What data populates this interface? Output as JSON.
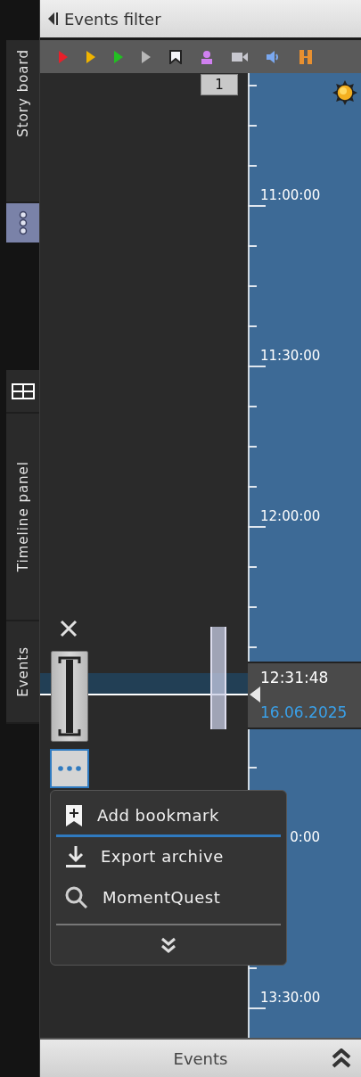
{
  "sidebar": {
    "items": [
      {
        "kind": "tab",
        "label": "Story board"
      },
      {
        "kind": "more"
      },
      {
        "kind": "layout"
      },
      {
        "kind": "tab",
        "label": "Timeline panel"
      },
      {
        "kind": "tab",
        "label": "Events"
      }
    ]
  },
  "header": {
    "title": "Events filter"
  },
  "filters": [
    {
      "kind": "triangle",
      "color": "#e8202a"
    },
    {
      "kind": "triangle",
      "color": "#f0b400"
    },
    {
      "kind": "triangle",
      "color": "#22c022"
    },
    {
      "kind": "triangle",
      "color": "#b8b8b8"
    },
    {
      "kind": "bookmark",
      "color": "#f4f4f8"
    },
    {
      "kind": "person",
      "color": "#d080f0"
    },
    {
      "kind": "camera",
      "color": "#c8c8d0"
    },
    {
      "kind": "speaker",
      "color": "#7aa8f0"
    },
    {
      "kind": "bars",
      "color": "#e89030"
    }
  ],
  "badge": "1",
  "timeline": {
    "ticks": [
      {
        "kind": "major",
        "label": "11:00:00"
      },
      {
        "kind": "major",
        "label": "11:30:00"
      },
      {
        "kind": "major",
        "label": "12:00:00"
      },
      {
        "kind": "cursor",
        "time": "12:31:48",
        "date": "16.06.2025"
      },
      {
        "kind": "partial",
        "label": "0:00"
      },
      {
        "kind": "major",
        "label": "13:30:00"
      }
    ]
  },
  "menu": {
    "items": [
      {
        "kind": "bookmark",
        "label": "Add bookmark",
        "selected": true
      },
      {
        "kind": "export",
        "label": "Export archive",
        "selected": false
      },
      {
        "kind": "search",
        "label": "MomentQuest",
        "selected": false
      }
    ]
  },
  "bottom_bar": {
    "title": "Events"
  }
}
